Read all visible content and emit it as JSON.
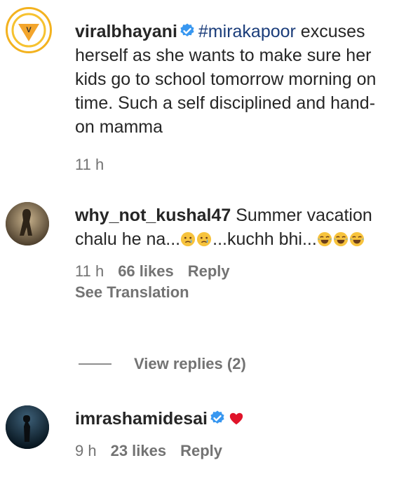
{
  "comments": [
    {
      "username": "viralbhayani",
      "verified": true,
      "hashtag": "#mirakapoor",
      "text": " excuses herself as she wants to make sure her kids go to school tomorrow morning on time. Such a self disciplined and hand-on mamma",
      "time": "11 h"
    },
    {
      "username": "why_not_kushal47",
      "verified": false,
      "text_part1": " Summer vacation chalu he na...",
      "text_part2": "...kuchh bhi...",
      "emoji_cry": "crying-face",
      "emoji_laugh": "tears-of-joy-face",
      "time": "11 h",
      "likes": "66 likes",
      "reply": "Reply",
      "see_translation": "See Translation",
      "view_replies": "View replies (2)"
    },
    {
      "username": "imrashamidesai",
      "verified": true,
      "emoji_heart": "red-heart",
      "time": "9 h",
      "likes": "23 likes",
      "reply": "Reply"
    }
  ],
  "colors": {
    "text": "#262626",
    "meta": "#737373",
    "hashtag": "#1b3d7a",
    "verified": "#3897f0",
    "heart": "#e0142a"
  }
}
